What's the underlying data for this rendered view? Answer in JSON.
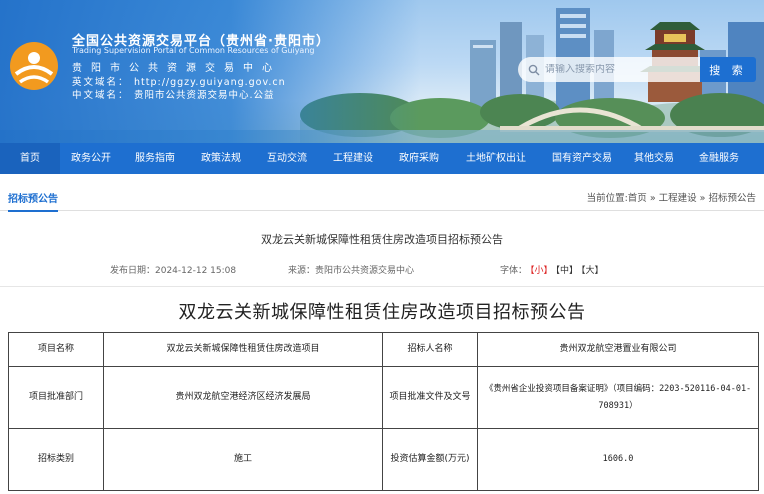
{
  "header": {
    "site_title": "全国公共资源交易平台（贵州省·贵阳市）",
    "site_subtitle": "Trading Supervision Portal of Common Resources of Guiyang",
    "site_name_cn": "贵阳市公共资源交易中心",
    "domain_en_label": "英文域名：",
    "domain_en_value": "http://ggzy.guiyang.gov.cn",
    "domain_cn_label": "中文域名：",
    "domain_cn_value": "贵阳市公共资源交易中心.公益",
    "search_placeholder": "请输入搜索内容",
    "search_button": "搜 索"
  },
  "nav": {
    "items": [
      {
        "label": "首页"
      },
      {
        "label": "政务公开"
      },
      {
        "label": "服务指南"
      },
      {
        "label": "政策法规"
      },
      {
        "label": "互动交流"
      },
      {
        "label": "工程建设"
      },
      {
        "label": "政府采购"
      },
      {
        "label": "土地矿权出让"
      },
      {
        "label": "国有资产交易"
      },
      {
        "label": "其他交易"
      },
      {
        "label": "金融服务"
      }
    ]
  },
  "breadcrumb": {
    "section": "招标预公告",
    "path": "当前位置:首页 » 工程建设 » 招标预公告"
  },
  "article": {
    "title": "双龙云关新城保障性租赁住房改造项目招标预公告",
    "publish_date": "发布日期：2024-12-12 15:08",
    "source": "来源：贵阳市公共资源交易中心",
    "font_label": "字体：",
    "font_small": "【小】",
    "font_medium": "【中】",
    "font_large": "【大】",
    "heading": "双龙云关新城保障性租赁住房改造项目招标预公告"
  },
  "table": {
    "rows": [
      [
        "项目名称",
        "双龙云关新城保障性租赁住房改造项目",
        "招标人名称",
        "贵州双龙航空港置业有限公司"
      ],
      [
        "项目批准部门",
        "贵州双龙航空港经济区经济发展局",
        "项目批准文件及文号",
        "《贵州省企业投资项目备案证明》（项目编码：2203-520116-04-01-708931）"
      ],
      [
        "招标类别",
        "施工",
        "投资估算金额(万元)",
        "1606.0"
      ]
    ]
  },
  "colors": {
    "primary_blue": "#1e6fd0",
    "accent_red": "#d22222"
  }
}
